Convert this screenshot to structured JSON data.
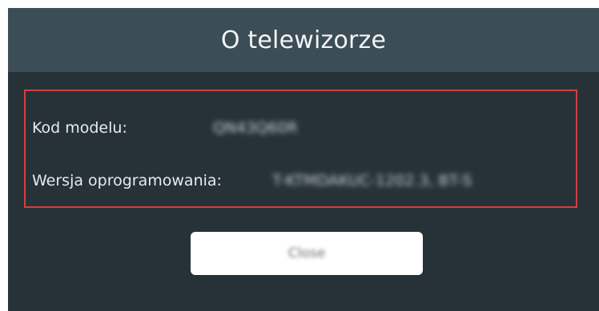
{
  "dialog": {
    "title": "O telewizorze",
    "info": {
      "model_label": "Kod modelu:",
      "model_value": "QN43Q60R",
      "software_label": "Wersja oprogramowania:",
      "software_value": "T-KTMDAKUC-1202.3, BT-S"
    },
    "close_button_label": "Close"
  },
  "colors": {
    "dialog_background": "#263238",
    "header_background": "#3b4d56",
    "highlight_border": "#d43f3f",
    "button_background": "#ffffff"
  }
}
